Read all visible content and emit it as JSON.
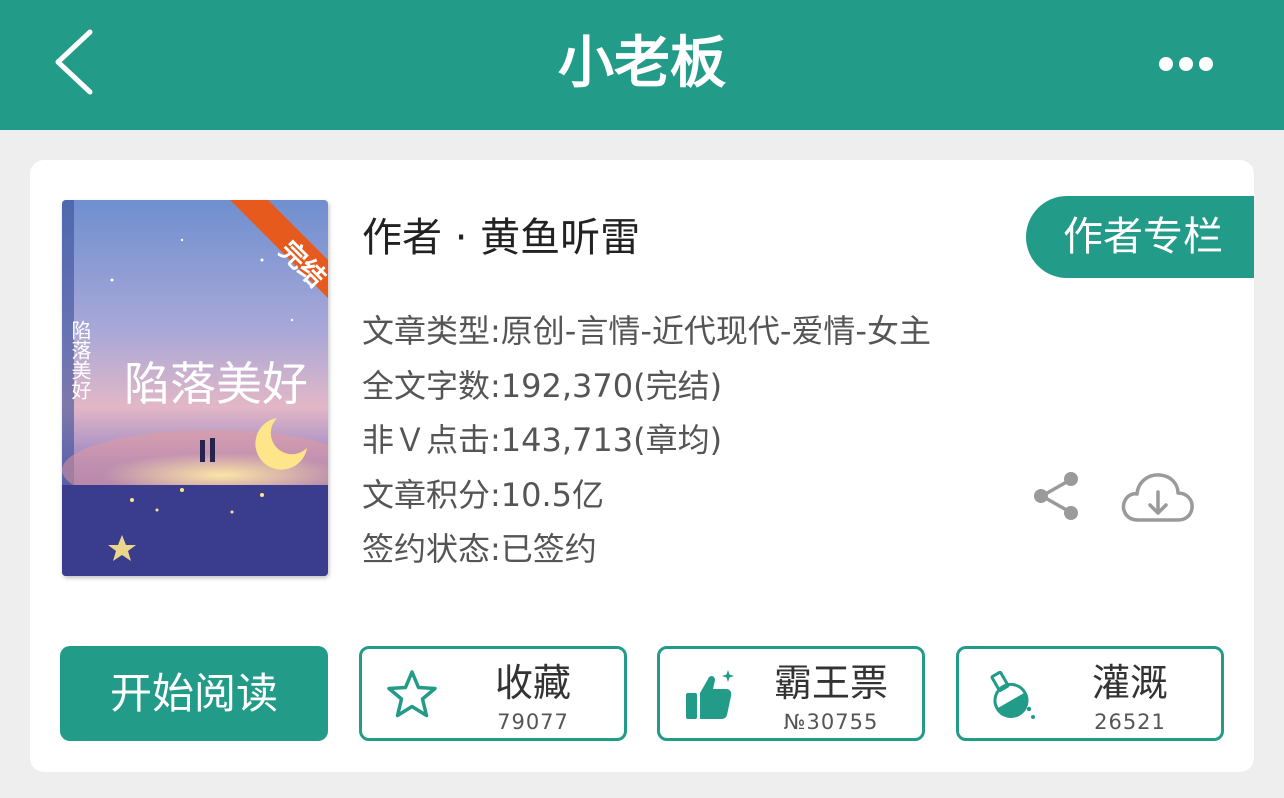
{
  "header": {
    "title": "小老板",
    "back_icon": "chevron-left-icon",
    "more_icon": "more-dots-icon"
  },
  "book": {
    "cover": {
      "title_art": "陷落美好",
      "badge": "完结"
    },
    "author_line": "作者 · 黄鱼听雷",
    "author_column_label": "作者专栏",
    "info": [
      "文章类型:原创-言情-近代现代-爱情-女主",
      "全文字数:192,370(完结)",
      "非Ｖ点击:143,713(章均)",
      "文章积分:10.5亿",
      "签约状态:已签约"
    ],
    "share_icon": "share-icon",
    "download_icon": "cloud-download-icon"
  },
  "actions": {
    "start_read": "开始阅读",
    "favorite": {
      "label": "收藏",
      "count": "79077",
      "icon": "star-icon"
    },
    "bawang": {
      "label": "霸王票",
      "count": "№30755",
      "icon": "thumbs-up-icon"
    },
    "water": {
      "label": "灌溉",
      "count": "26521",
      "icon": "flask-icon"
    }
  },
  "colors": {
    "accent": "#229b89",
    "text_dark": "#222222",
    "text_gray": "#555555",
    "icon_gray": "#9a9a9a",
    "badge": "#e65a1e"
  }
}
